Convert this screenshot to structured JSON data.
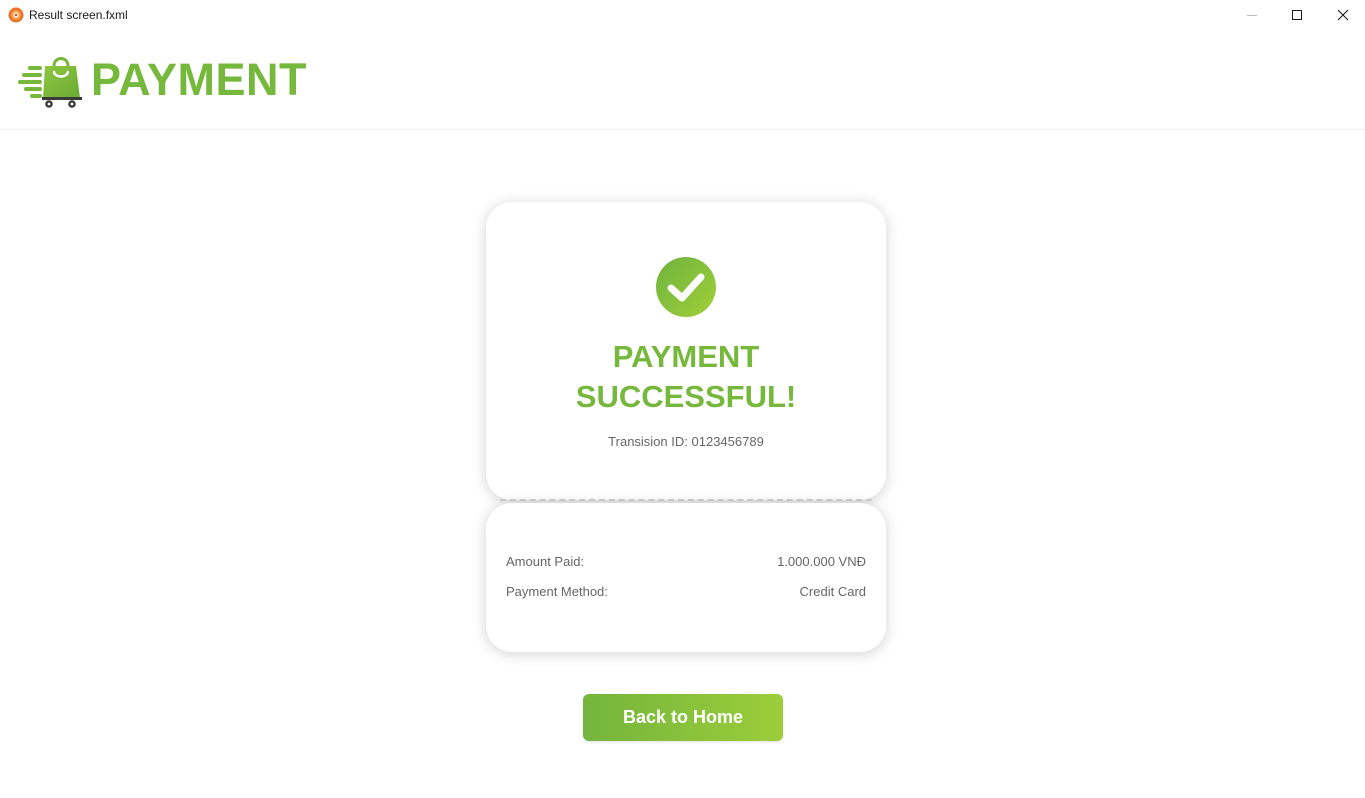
{
  "window": {
    "title": "Result screen.fxml",
    "controls": [
      "minimize",
      "maximize",
      "close"
    ]
  },
  "header": {
    "logo_text": "PAYMENT",
    "logo_icon": "delivery-cart-bag-icon"
  },
  "result": {
    "icon": "check-circle-icon",
    "title_line1": "PAYMENT",
    "title_line2": "SUCCESSFUL!",
    "transaction_label": "Transision ID:",
    "transaction_id": "0123456789"
  },
  "details": {
    "amount_label": "Amount Paid:",
    "amount_value": "1.000.000 VNĐ",
    "method_label": "Payment Method:",
    "method_value": "Credit Card"
  },
  "actions": {
    "back_home_label": "Back to Home"
  },
  "colors": {
    "brand_green": "#76b83c",
    "button_gradient_start": "#74b53d",
    "button_gradient_end": "#9ccd3a",
    "muted_text": "#666666"
  }
}
